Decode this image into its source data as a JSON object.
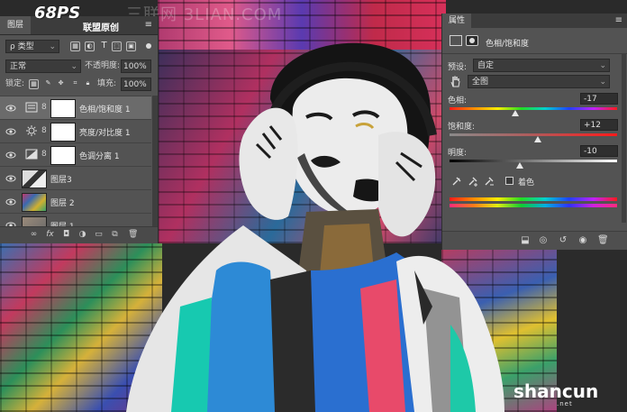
{
  "watermark": "三联网 3LIAN.COM",
  "layers_panel": {
    "tab": "图层",
    "brand_logo": "68PS",
    "brand_sub": "联盟原创",
    "filter_kind": "ρ 类型",
    "blend_mode": "正常",
    "opacity_label": "不透明度:",
    "opacity_value": "100%",
    "lock_label": "锁定:",
    "fill_label": "填充:",
    "fill_value": "100%",
    "layers": [
      {
        "name": "色相/饱和度 1",
        "type": "hue-saturation",
        "selected": true
      },
      {
        "name": "亮度/对比度 1",
        "type": "brightness-contrast",
        "selected": false
      },
      {
        "name": "色调分离 1",
        "type": "posterize",
        "selected": false
      },
      {
        "name": "图层3",
        "type": "pixel",
        "selected": false
      },
      {
        "name": "图层 2",
        "type": "pixel",
        "selected": false
      },
      {
        "name": "图层 1",
        "type": "pixel",
        "selected": false
      }
    ]
  },
  "properties_panel": {
    "tab": "属性",
    "title": "色相/饱和度",
    "preset_label": "预设:",
    "preset_value": "自定",
    "channel_value": "全图",
    "hue_label": "色相:",
    "hue_value": "-17",
    "saturation_label": "饱和度:",
    "saturation_value": "+12",
    "lightness_label": "明度:",
    "lightness_value": "-10",
    "colorize_label": "着色"
  },
  "site_mark": {
    "text": "shancun",
    "sub": ".net"
  },
  "colors": {
    "panel": "#535353",
    "panel_dark": "#3c3c3c",
    "selected_row": "#6b6b6b"
  }
}
